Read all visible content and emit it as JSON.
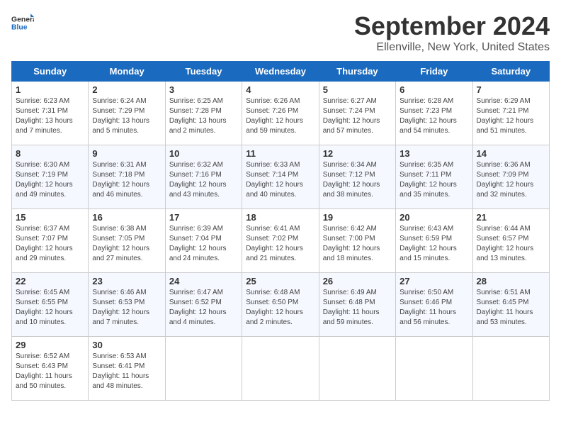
{
  "header": {
    "logo_general": "General",
    "logo_blue": "Blue",
    "title": "September 2024",
    "subtitle": "Ellenville, New York, United States"
  },
  "columns": [
    "Sunday",
    "Monday",
    "Tuesday",
    "Wednesday",
    "Thursday",
    "Friday",
    "Saturday"
  ],
  "weeks": [
    [
      {
        "day": "1",
        "info": "Sunrise: 6:23 AM\nSunset: 7:31 PM\nDaylight: 13 hours and 7 minutes."
      },
      {
        "day": "2",
        "info": "Sunrise: 6:24 AM\nSunset: 7:29 PM\nDaylight: 13 hours and 5 minutes."
      },
      {
        "day": "3",
        "info": "Sunrise: 6:25 AM\nSunset: 7:28 PM\nDaylight: 13 hours and 2 minutes."
      },
      {
        "day": "4",
        "info": "Sunrise: 6:26 AM\nSunset: 7:26 PM\nDaylight: 12 hours and 59 minutes."
      },
      {
        "day": "5",
        "info": "Sunrise: 6:27 AM\nSunset: 7:24 PM\nDaylight: 12 hours and 57 minutes."
      },
      {
        "day": "6",
        "info": "Sunrise: 6:28 AM\nSunset: 7:23 PM\nDaylight: 12 hours and 54 minutes."
      },
      {
        "day": "7",
        "info": "Sunrise: 6:29 AM\nSunset: 7:21 PM\nDaylight: 12 hours and 51 minutes."
      }
    ],
    [
      {
        "day": "8",
        "info": "Sunrise: 6:30 AM\nSunset: 7:19 PM\nDaylight: 12 hours and 49 minutes."
      },
      {
        "day": "9",
        "info": "Sunrise: 6:31 AM\nSunset: 7:18 PM\nDaylight: 12 hours and 46 minutes."
      },
      {
        "day": "10",
        "info": "Sunrise: 6:32 AM\nSunset: 7:16 PM\nDaylight: 12 hours and 43 minutes."
      },
      {
        "day": "11",
        "info": "Sunrise: 6:33 AM\nSunset: 7:14 PM\nDaylight: 12 hours and 40 minutes."
      },
      {
        "day": "12",
        "info": "Sunrise: 6:34 AM\nSunset: 7:12 PM\nDaylight: 12 hours and 38 minutes."
      },
      {
        "day": "13",
        "info": "Sunrise: 6:35 AM\nSunset: 7:11 PM\nDaylight: 12 hours and 35 minutes."
      },
      {
        "day": "14",
        "info": "Sunrise: 6:36 AM\nSunset: 7:09 PM\nDaylight: 12 hours and 32 minutes."
      }
    ],
    [
      {
        "day": "15",
        "info": "Sunrise: 6:37 AM\nSunset: 7:07 PM\nDaylight: 12 hours and 29 minutes."
      },
      {
        "day": "16",
        "info": "Sunrise: 6:38 AM\nSunset: 7:05 PM\nDaylight: 12 hours and 27 minutes."
      },
      {
        "day": "17",
        "info": "Sunrise: 6:39 AM\nSunset: 7:04 PM\nDaylight: 12 hours and 24 minutes."
      },
      {
        "day": "18",
        "info": "Sunrise: 6:41 AM\nSunset: 7:02 PM\nDaylight: 12 hours and 21 minutes."
      },
      {
        "day": "19",
        "info": "Sunrise: 6:42 AM\nSunset: 7:00 PM\nDaylight: 12 hours and 18 minutes."
      },
      {
        "day": "20",
        "info": "Sunrise: 6:43 AM\nSunset: 6:59 PM\nDaylight: 12 hours and 15 minutes."
      },
      {
        "day": "21",
        "info": "Sunrise: 6:44 AM\nSunset: 6:57 PM\nDaylight: 12 hours and 13 minutes."
      }
    ],
    [
      {
        "day": "22",
        "info": "Sunrise: 6:45 AM\nSunset: 6:55 PM\nDaylight: 12 hours and 10 minutes."
      },
      {
        "day": "23",
        "info": "Sunrise: 6:46 AM\nSunset: 6:53 PM\nDaylight: 12 hours and 7 minutes."
      },
      {
        "day": "24",
        "info": "Sunrise: 6:47 AM\nSunset: 6:52 PM\nDaylight: 12 hours and 4 minutes."
      },
      {
        "day": "25",
        "info": "Sunrise: 6:48 AM\nSunset: 6:50 PM\nDaylight: 12 hours and 2 minutes."
      },
      {
        "day": "26",
        "info": "Sunrise: 6:49 AM\nSunset: 6:48 PM\nDaylight: 11 hours and 59 minutes."
      },
      {
        "day": "27",
        "info": "Sunrise: 6:50 AM\nSunset: 6:46 PM\nDaylight: 11 hours and 56 minutes."
      },
      {
        "day": "28",
        "info": "Sunrise: 6:51 AM\nSunset: 6:45 PM\nDaylight: 11 hours and 53 minutes."
      }
    ],
    [
      {
        "day": "29",
        "info": "Sunrise: 6:52 AM\nSunset: 6:43 PM\nDaylight: 11 hours and 50 minutes."
      },
      {
        "day": "30",
        "info": "Sunrise: 6:53 AM\nSunset: 6:41 PM\nDaylight: 11 hours and 48 minutes."
      },
      {
        "day": "",
        "info": ""
      },
      {
        "day": "",
        "info": ""
      },
      {
        "day": "",
        "info": ""
      },
      {
        "day": "",
        "info": ""
      },
      {
        "day": "",
        "info": ""
      }
    ]
  ]
}
